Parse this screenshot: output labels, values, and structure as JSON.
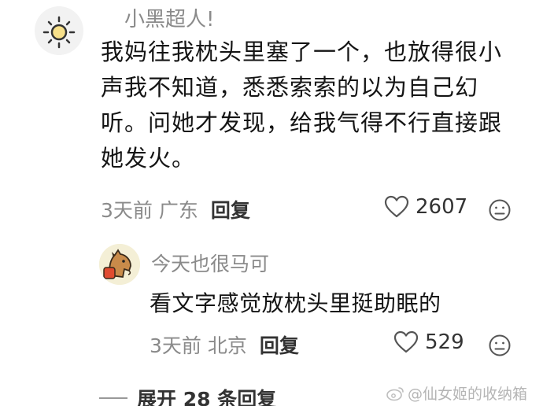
{
  "main_comment": {
    "username": "小黑超人!",
    "content": "我妈往我枕头里塞了一个，也放得很小声我不知道，悉悉索索的以为自己幻听。问她才发现，给我气得不行直接跟她发火。",
    "time_location": "3天前 广东",
    "reply_label": "回复",
    "likes": "2607"
  },
  "reply_comment": {
    "username": "今天也很马可",
    "content": "看文字感觉放枕头里挺助眠的",
    "time_location": "3天前 北京",
    "reply_label": "回复",
    "likes": "529"
  },
  "expand": {
    "label": "展开 28 条回复"
  },
  "watermark": {
    "text": "@仙女姬的收纳箱"
  },
  "icons": {
    "heart": "heart-outline-icon",
    "dislike": "unhappy-face-icon",
    "main_avatar": "sun-avatar",
    "reply_avatar": "horse-avatar"
  }
}
